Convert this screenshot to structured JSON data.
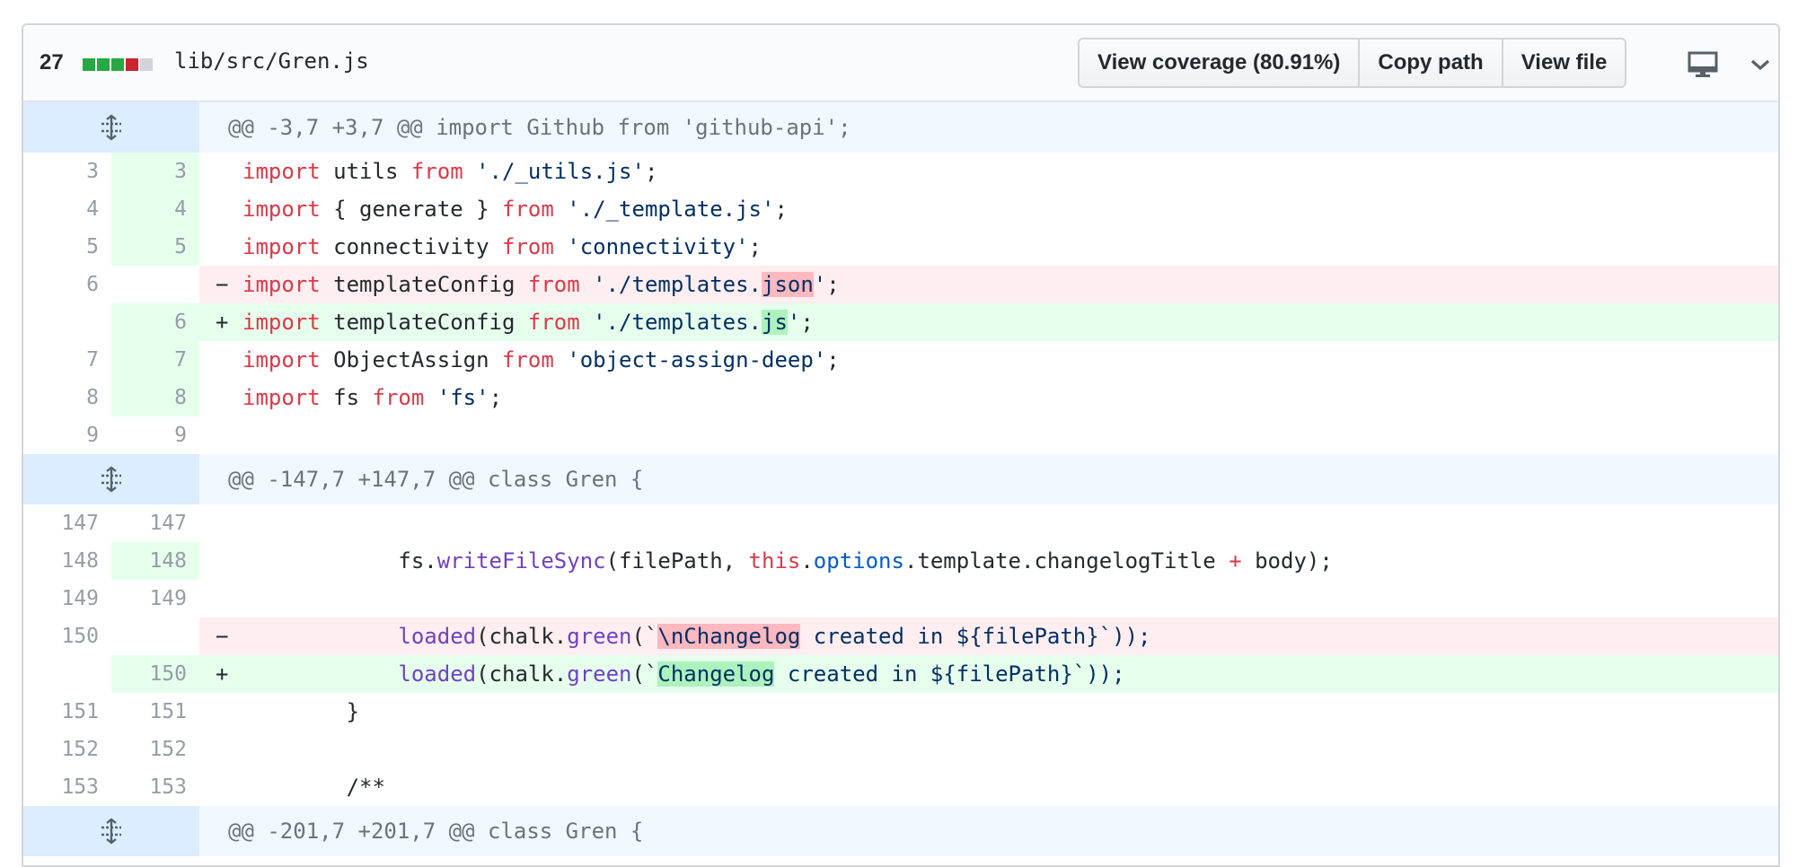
{
  "file": {
    "changes_count": "27",
    "diffstat_blocks": [
      "#28a745",
      "#28a745",
      "#28a745",
      "#cb2431",
      "#d1d5da"
    ],
    "path": "lib/src/Gren.js",
    "buttons": {
      "view_coverage": "View coverage (80.91%)",
      "copy_path": "Copy path",
      "view_file": "View file"
    },
    "icons": {
      "display": "desktop-icon",
      "collapse": "chevron-down-icon",
      "expand": "unfold-icon"
    }
  },
  "hunks": [
    {
      "header": "@@ -3,7 +3,7 @@ import Github from 'github-api';",
      "lines": [
        {
          "old": "3",
          "new": "3",
          "type": "ctx"
        },
        {
          "old": "4",
          "new": "4",
          "type": "ctx"
        },
        {
          "old": "5",
          "new": "5",
          "type": "ctx"
        },
        {
          "old": "6",
          "new": "",
          "type": "del"
        },
        {
          "old": "",
          "new": "6",
          "type": "add"
        },
        {
          "old": "7",
          "new": "7",
          "type": "ctx"
        },
        {
          "old": "8",
          "new": "8",
          "type": "ctx"
        },
        {
          "old": "9",
          "new": "9",
          "type": "ctx"
        }
      ]
    },
    {
      "header": "@@ -147,7 +147,7 @@ class Gren {",
      "lines": [
        {
          "old": "147",
          "new": "147",
          "type": "ctx"
        },
        {
          "old": "148",
          "new": "148",
          "type": "ctx"
        },
        {
          "old": "149",
          "new": "149",
          "type": "ctx"
        },
        {
          "old": "150",
          "new": "",
          "type": "del"
        },
        {
          "old": "",
          "new": "150",
          "type": "add"
        },
        {
          "old": "151",
          "new": "151",
          "type": "ctx"
        },
        {
          "old": "152",
          "new": "152",
          "type": "ctx"
        },
        {
          "old": "153",
          "new": "153",
          "type": "ctx"
        }
      ]
    },
    {
      "header": "@@ -201,7 +201,7 @@ class Gren {",
      "lines": []
    }
  ],
  "code": {
    "kw_import": "import",
    "kw_from": "from",
    "kw_this": "this",
    "plus_op": "+",
    "minus_marker": "−",
    "plus_marker": "+",
    "h1_l1_ident": "utils",
    "h1_l1_str": "'./_utils.js'",
    "h1_l2_ident": "{ generate }",
    "h1_l2_str": "'./_template.js'",
    "h1_l3_ident": "connectivity",
    "h1_l3_str": "'connectivity'",
    "h1_l4_ident": "templateConfig",
    "h1_l4_str_a": "'./templates.",
    "h1_l4_str_hl": "json",
    "h1_l4_str_b": "'",
    "h1_l5_ident": "templateConfig",
    "h1_l5_str_a": "'./templates.",
    "h1_l5_str_hl": "js",
    "h1_l5_str_b": "'",
    "h1_l6_ident": "ObjectAssign",
    "h1_l6_str": "'object-assign-deep'",
    "h1_l7_ident": "fs",
    "h1_l7_str": "'fs'",
    "semicolon": ";",
    "h2_l2_a": "fs.",
    "h2_l2_fn": "writeFileSync",
    "h2_l2_b": "(filePath, ",
    "h2_l2_c": ".",
    "h2_l2_cn": "options",
    "h2_l2_d": ".template.changelogTitle ",
    "h2_l2_e": " body);",
    "h2_fn_loaded": "loaded",
    "h2_chalk": "(chalk.",
    "h2_fn_green": "green",
    "h2_bt": "(`",
    "h2_l4_hl": "\\nChangelog",
    "h2_l5_hl": "Changelog",
    "h2_tail": " created in ${filePath}`));",
    "h2_l6": "}",
    "h2_l8": "/**"
  }
}
